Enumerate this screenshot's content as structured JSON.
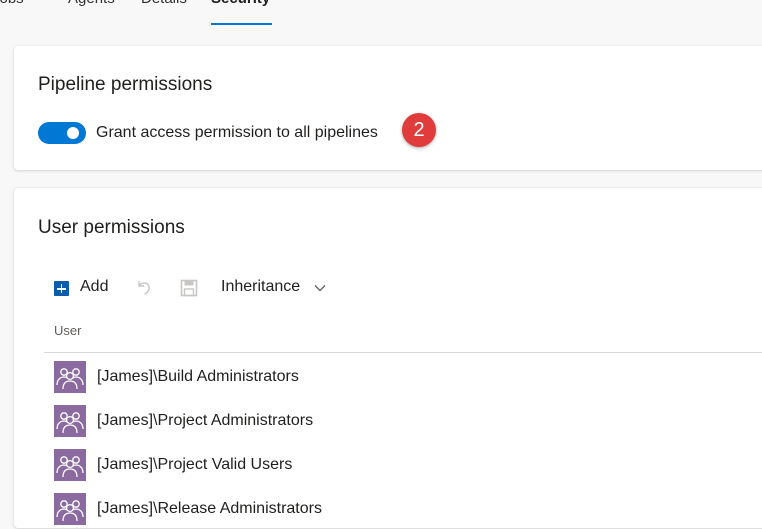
{
  "tabs": [
    {
      "label": "Jobs"
    },
    {
      "label": "Agents"
    },
    {
      "label": "Details"
    },
    {
      "label": "Security",
      "active": true
    }
  ],
  "pipeline_permissions": {
    "title": "Pipeline permissions",
    "toggle_label": "Grant access permission to all pipelines",
    "toggle_on": true,
    "badge": "2"
  },
  "user_permissions": {
    "title": "User permissions",
    "toolbar": {
      "add_label": "Add",
      "undo_icon": "undo-icon",
      "save_icon": "save-icon",
      "inheritance_label": "Inheritance"
    },
    "column_header": "User",
    "rows": [
      {
        "name": "[James]\\Build Administrators"
      },
      {
        "name": "[James]\\Project Administrators"
      },
      {
        "name": "[James]\\Project Valid Users"
      },
      {
        "name": "[James]\\Release Administrators"
      }
    ]
  },
  "colors": {
    "accent": "#0078d4",
    "badge": "#e03c3c",
    "group_icon": "#8a6a9f"
  }
}
